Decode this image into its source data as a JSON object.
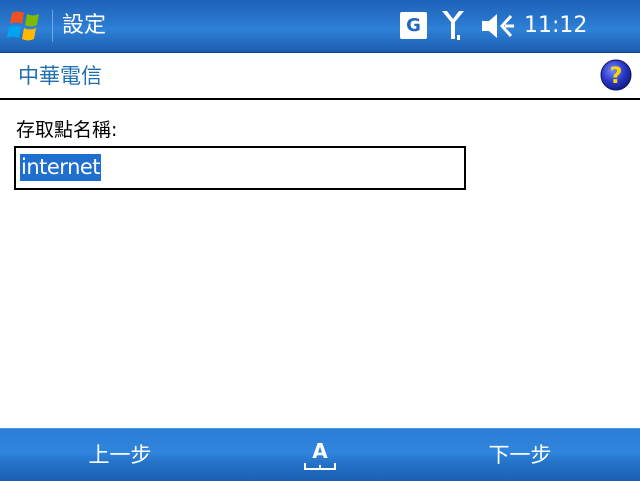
{
  "status_bar": {
    "app_title": "設定",
    "network_badge": "G",
    "time": "11:12",
    "icons": [
      "windows-start-icon",
      "network-g-icon",
      "signal-strength-icon",
      "speaker-muted-icon"
    ]
  },
  "header": {
    "title": "中華電信",
    "help_icon": "help-icon"
  },
  "form": {
    "label": "存取點名稱:",
    "value": "internet"
  },
  "menu_bar": {
    "left": "上一步",
    "input_mode": "A",
    "right": "下一步"
  },
  "colors": {
    "titlebar": "#2a78d0",
    "menubar": "#2f85dc",
    "header_text": "#1f6fb0",
    "selection": "#1f6fd0"
  }
}
